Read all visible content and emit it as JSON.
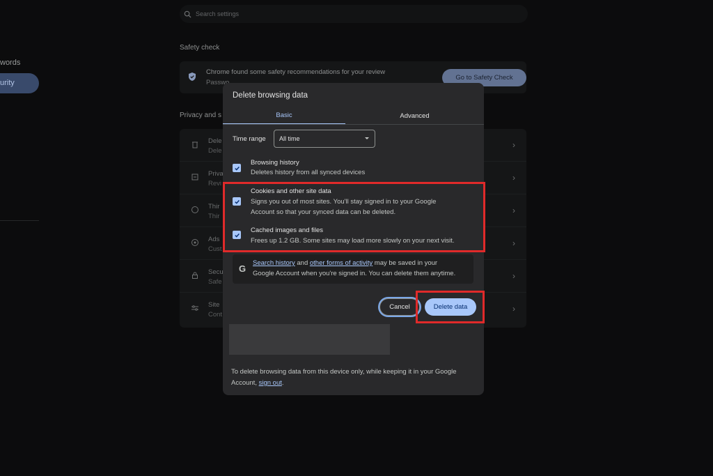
{
  "sidebar": {
    "items": [
      {
        "label": "words"
      },
      {
        "label": "urity"
      }
    ]
  },
  "search": {
    "placeholder": "Search settings"
  },
  "safety": {
    "section_title": "Safety check",
    "message": "Chrome found some safety recommendations for your review",
    "sub": "Passwo",
    "button": "Go to Safety Check"
  },
  "privacy": {
    "section_title": "Privacy and s",
    "rows": [
      {
        "a": "Dele",
        "b": "Dele"
      },
      {
        "a": "Priva",
        "b": "Revi"
      },
      {
        "a": "Thir",
        "b": "Thir"
      },
      {
        "a": "Ads",
        "b": "Cust"
      },
      {
        "a": "Secu",
        "b": "Safe"
      },
      {
        "a": "Site",
        "b": "Cont"
      }
    ]
  },
  "dialog": {
    "title": "Delete browsing data",
    "tabs": [
      "Basic",
      "Advanced"
    ],
    "active_tab": "Basic",
    "time_range_label": "Time range",
    "time_range_value": "All time",
    "options": [
      {
        "title": "Browsing history",
        "desc": "Deletes history from all synced devices",
        "checked": true
      },
      {
        "title": "Cookies and other site data",
        "desc1": "Signs you out of most sites. You'll stay signed in to your Google",
        "desc2": "Account so that your synced data can be deleted.",
        "checked": true
      },
      {
        "title": "Cached images and files",
        "desc": "Frees up 1.2 GB. Some sites may load more slowly on your next visit.",
        "checked": true
      }
    ],
    "google_note": {
      "link1": "Search history",
      "and": "and",
      "link2": "other forms of activity",
      "rest1": "may be saved in your",
      "line2": "Google Account when you're signed in. You can delete them anytime."
    },
    "cancel": "Cancel",
    "delete": "Delete data",
    "footer1": "To delete browsing data from this device only, while keeping it in your Google",
    "footer2_prefix": "Account,",
    "footer2_link": "sign out",
    "footer2_suffix": "."
  },
  "colors": {
    "accent": "#a8c7fa",
    "highlight": "#e02a2a",
    "dialog_bg": "#29292b",
    "page_bg": "#0c0c0d"
  }
}
